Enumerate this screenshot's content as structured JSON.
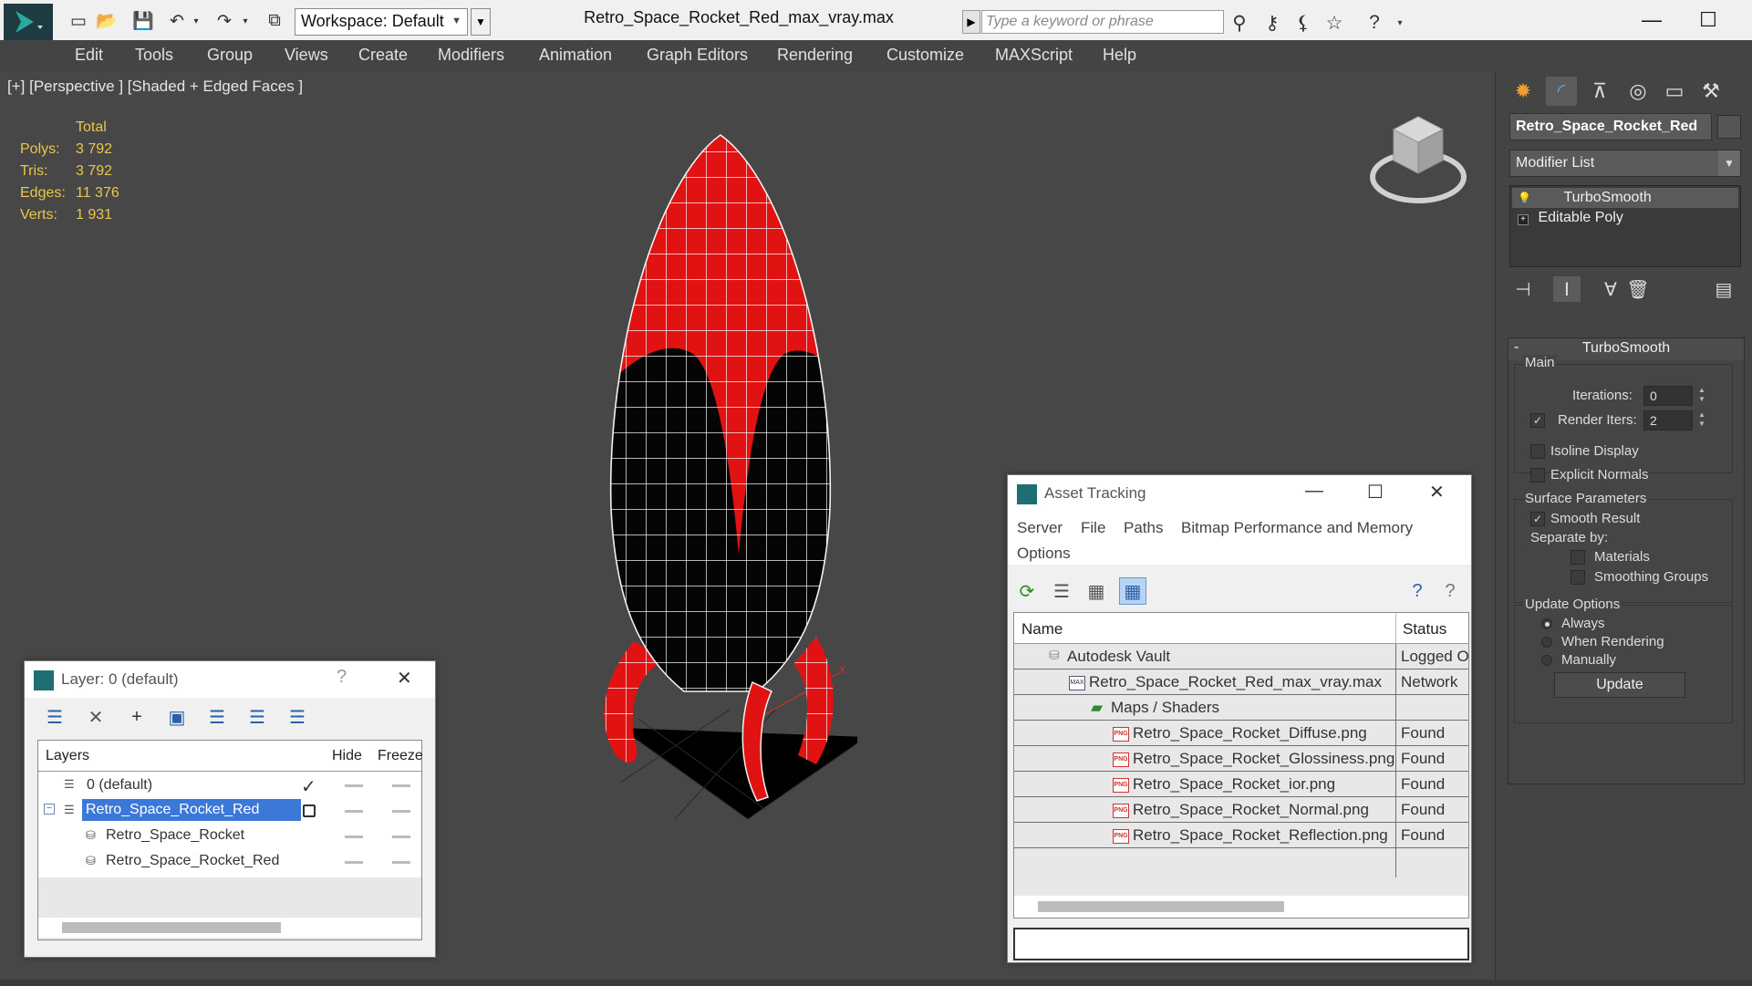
{
  "title_bar": {
    "workspace_label": "Workspace: Default",
    "document_title": "Retro_Space_Rocket_Red_max_vray.max",
    "search_placeholder": "Type a keyword or phrase"
  },
  "menu": [
    "Edit",
    "Tools",
    "Group",
    "Views",
    "Create",
    "Modifiers",
    "Animation",
    "Graph Editors",
    "Rendering",
    "Customize",
    "MAXScript",
    "Help"
  ],
  "viewport": {
    "label": "[+] [Perspective ] [Shaded + Edged Faces ]",
    "stats": {
      "header": "Total",
      "rows": [
        {
          "label": "Polys:",
          "value": "3 792"
        },
        {
          "label": "Tris:",
          "value": "3 792"
        },
        {
          "label": "Edges:",
          "value": "11 376"
        },
        {
          "label": "Verts:",
          "value": "1 931"
        }
      ]
    },
    "axis_x_label": "x"
  },
  "command_panel": {
    "object_name": "Retro_Space_Rocket_Red",
    "modifier_list": "Modifier List",
    "stack": [
      "TurboSmooth",
      "Editable Poly"
    ],
    "rollout_title": "TurboSmooth",
    "rollout_toggle": "-",
    "main_group": "Main",
    "iterations_label": "Iterations:",
    "iterations_value": "0",
    "render_iters_label": "Render Iters:",
    "render_iters_value": "2",
    "render_iters_checked": "✓",
    "isoline_label": "Isoline Display",
    "explicit_normals_label": "Explicit Normals",
    "surface_group": "Surface Parameters",
    "smooth_result_label": "Smooth Result",
    "smooth_result_checked": "✓",
    "separate_by_label": "Separate by:",
    "materials_label": "Materials",
    "smoothing_groups_label": "Smoothing Groups",
    "update_group": "Update Options",
    "always_label": "Always",
    "when_rendering_label": "When Rendering",
    "manually_label": "Manually",
    "update_button": "Update"
  },
  "layer_window": {
    "title": "Layer: 0 (default)",
    "help": "?",
    "columns": [
      "Layers",
      "Hide",
      "Freeze"
    ],
    "rows": [
      {
        "name": "0 (default)",
        "check": "✓"
      },
      {
        "name": "Retro_Space_Rocket_Red",
        "selected": true
      },
      {
        "name": "Retro_Space_Rocket"
      },
      {
        "name": "Retro_Space_Rocket_Red"
      }
    ]
  },
  "asset_window": {
    "title": "Asset Tracking",
    "menu": [
      "Server",
      "File",
      "Paths",
      "Bitmap Performance and Memory",
      "Options"
    ],
    "columns": [
      "Name",
      "Status"
    ],
    "png_badge": "PNG",
    "max_badge": "MAX",
    "rows": [
      {
        "name": "Autodesk Vault",
        "status": "Logged Out"
      },
      {
        "name": "Retro_Space_Rocket_Red_max_vray.max",
        "status": "Network"
      },
      {
        "name": "Maps / Shaders",
        "status": ""
      },
      {
        "name": "Retro_Space_Rocket_Diffuse.png",
        "status": "Found"
      },
      {
        "name": "Retro_Space_Rocket_Glossiness.png",
        "status": "Found"
      },
      {
        "name": "Retro_Space_Rocket_ior.png",
        "status": "Found"
      },
      {
        "name": "Retro_Space_Rocket_Normal.png",
        "status": "Found"
      },
      {
        "name": "Retro_Space_Rocket_Reflection.png",
        "status": "Found"
      }
    ]
  },
  "colors": {
    "rocket_red": "#e01212",
    "rocket_black": "#050505",
    "stats_yellow": "#e8c74c",
    "selection_blue": "#3c78d8"
  }
}
